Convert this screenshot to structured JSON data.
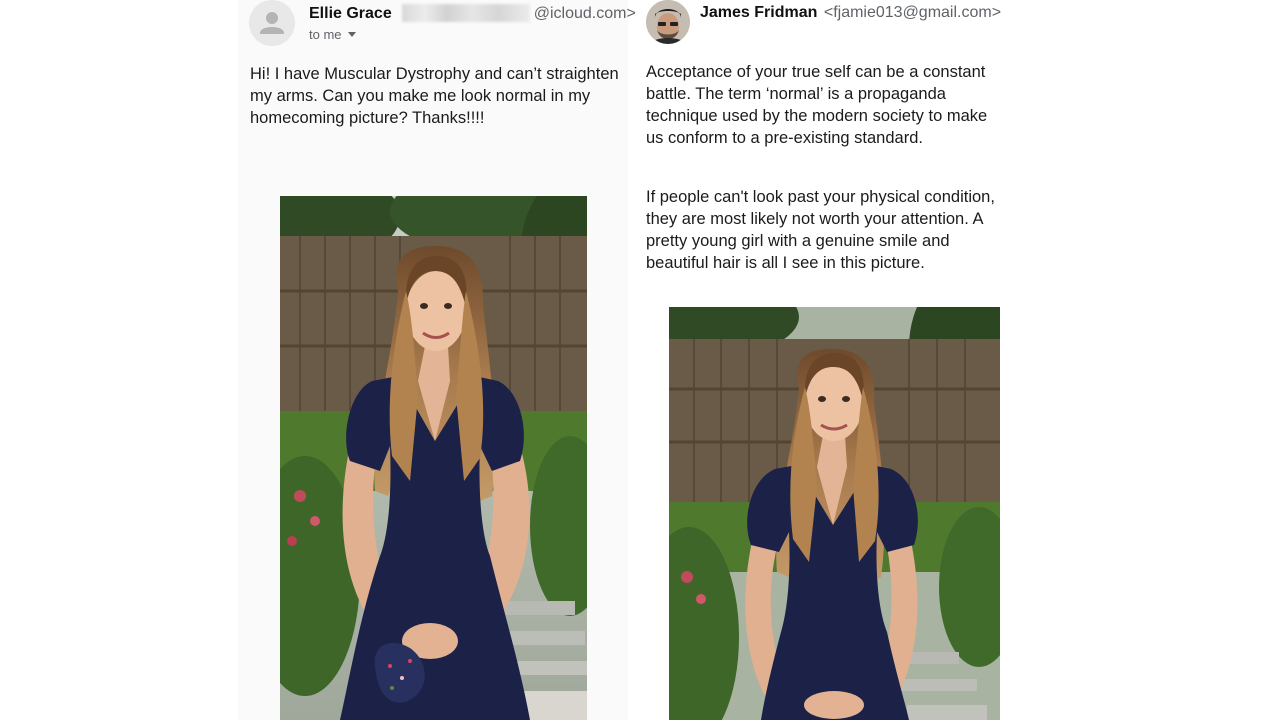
{
  "left_email": {
    "sender_name": "Ellie Grace",
    "sender_address_suffix": "@icloud.com>",
    "recipient_label": "to me",
    "message": "Hi! I have Muscular Dystrophy and can’t straighten my arms. Can you make me look normal in my homecoming picture? Thanks!!!!",
    "avatar_icon": "person-placeholder-icon",
    "attachment": "original homecoming photo"
  },
  "right_email": {
    "sender_name": "James Fridman",
    "sender_address": "<fjamie013@gmail.com>",
    "paragraph_1": "Acceptance of your true self can be a constant battle. The term ‘normal’ is a propaganda technique used by the modern society to make us conform to a pre-existing standard.",
    "paragraph_2": "If people can't look past your physical condition, they are most likely not worth your attention. A pretty young girl with a genuine smile and beautiful hair is all I see in this picture.",
    "attachment": "returned unedited photo"
  },
  "colors": {
    "dress": "#1c2247",
    "fence": "#6a5a48",
    "lawn": "#4f7a2e",
    "hair": "#a97a4c"
  }
}
